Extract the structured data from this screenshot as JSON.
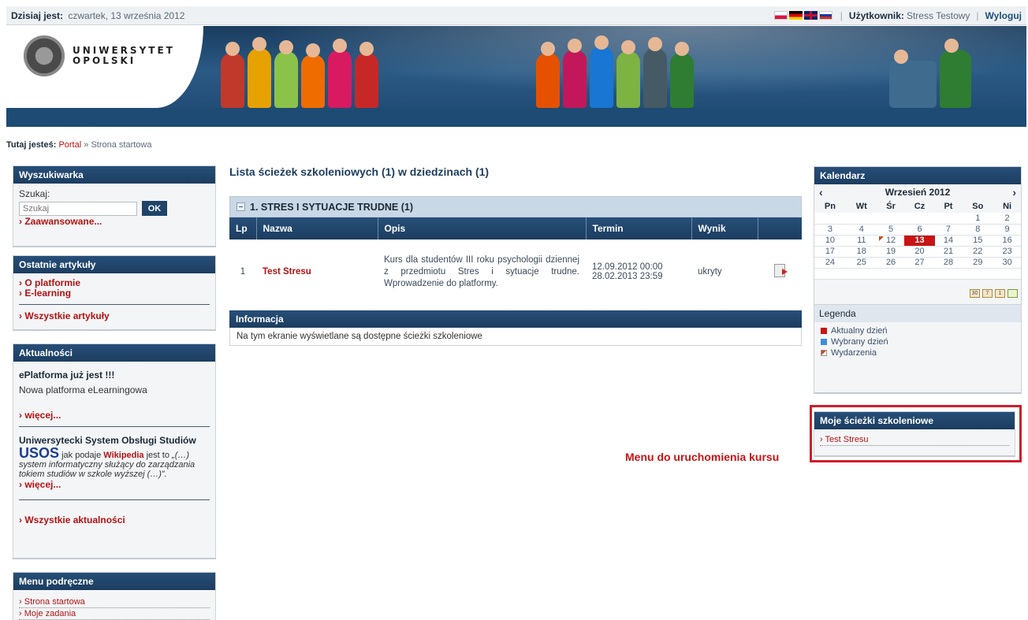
{
  "topbar": {
    "date_label": "Dzisiaj jest:",
    "date_value": "czwartek, 13 września 2012",
    "user_label": "Użytkownik:",
    "user_value": "Stress Testowy",
    "separator": "|",
    "logout": "Wyloguj",
    "flags": [
      "flag-pl-icon",
      "flag-de-icon",
      "flag-uk-icon",
      "flag-ru-icon"
    ]
  },
  "header": {
    "logo_line1": "UNIWERSYTET",
    "logo_line2": "OPOLSKI"
  },
  "breadcrumb": {
    "label": "Tutaj jesteś:",
    "portal": "Portal",
    "separator": "»",
    "current": "Strona startowa"
  },
  "search": {
    "title": "Wyszukiwarka",
    "label": "Szukaj:",
    "placeholder": "Szukaj",
    "button": "OK",
    "advanced": "Zaawansowane..."
  },
  "articles": {
    "title": "Ostatnie artykuły",
    "items": [
      "O platformie",
      "E-learning"
    ],
    "all": "Wszystkie artykuły"
  },
  "news": {
    "title": "Aktualności",
    "item1_title": "ePlatforma już jest !!!",
    "item1_text": "Nowa platforma eLearningowa",
    "more": "więcej...",
    "item2_title": "Uniwersytecki System Obsługi Studiów",
    "usos": "USOS",
    "usos_pre": "jak podaje",
    "wiki": "Wikipedia",
    "usos_post": "jest to",
    "usos_quote": "„(…) system informatyczny służący do zarządzania tokiem studiów w szkole wyższej (…)”.",
    "more2": "więcej...",
    "all": "Wszystkie aktualności"
  },
  "quickmenu": {
    "title": "Menu podręczne",
    "items": [
      "Strona startowa",
      "Moje zadania"
    ]
  },
  "main": {
    "title": "Lista ścieżek szkoleniowych (1) w dziedzinach (1)",
    "domain": "1. STRES I SYTUACJE TRUDNE (1)",
    "columns": [
      "Lp",
      "Nazwa",
      "Opis",
      "Termin",
      "Wynik",
      ""
    ],
    "rows": [
      {
        "lp": "1",
        "name": "Test Stresu",
        "desc": "Kurs dla studentów III roku psychologii dziennej z przedmiotu Stres i sytuacje trudne. Wprowadzenie do platformy.",
        "term_start": "12.09.2012 00:00",
        "term_end": "28.02.2013 23:59",
        "result": "ukryty"
      }
    ],
    "info_title": "Informacja",
    "info_text": "Na tym ekranie wyświetlane są dostępne ścieżki szkoleniowe"
  },
  "annotation": "Menu do uruchomienia kursu",
  "calendar": {
    "title": "Kalendarz",
    "month": "Wrzesień 2012",
    "prev": "‹",
    "next": "›",
    "days": [
      "Pn",
      "Wt",
      "Śr",
      "Cz",
      "Pt",
      "So",
      "Ni"
    ],
    "weeks": [
      [
        "",
        "",
        "",
        "",
        "",
        "1",
        "2"
      ],
      [
        "3",
        "4",
        "5",
        "6",
        "7",
        "8",
        "9"
      ],
      [
        "10",
        "11",
        "12",
        "13",
        "14",
        "15",
        "16"
      ],
      [
        "17",
        "18",
        "19",
        "20",
        "21",
        "22",
        "23"
      ],
      [
        "24",
        "25",
        "26",
        "27",
        "28",
        "29",
        "30"
      ],
      [
        "",
        "",
        "",
        "",
        "",
        "",
        ""
      ]
    ],
    "today": "13",
    "event_day": "12",
    "tools": [
      "30",
      "7",
      "1",
      ""
    ],
    "legend_title": "Legenda",
    "legend": [
      "Aktualny dzień",
      "Wybrany dzień",
      "Wydarzenia"
    ]
  },
  "mypaths": {
    "title": "Moje ścieżki szkoleniowe",
    "items": [
      "Test Stresu"
    ]
  },
  "colors": {
    "accent_red": "#b31212",
    "header_blue": "#1c3d60",
    "highlight": "#d01c2c"
  }
}
